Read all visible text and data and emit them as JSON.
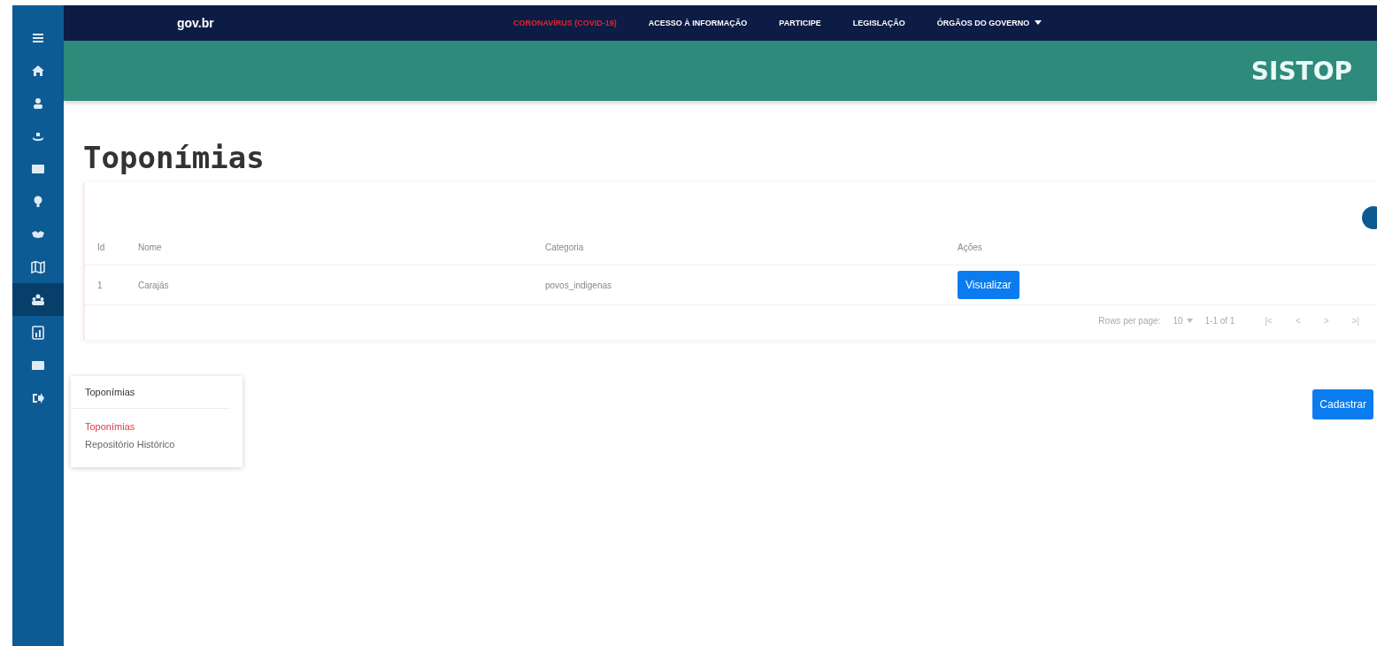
{
  "top_bar": {
    "logo": "gov.br",
    "links": [
      {
        "label": "CORONAVÍRUS (COVID-19)",
        "kind": "alert"
      },
      {
        "label": "ACESSO À INFORMAÇÃO",
        "kind": "normal"
      },
      {
        "label": "PARTICIPE",
        "kind": "normal"
      },
      {
        "label": "LEGISLAÇÃO",
        "kind": "normal"
      },
      {
        "label": "ÓRGÃOS DO GOVERNO",
        "kind": "dropdown"
      }
    ]
  },
  "header": {
    "title": "SISTOP"
  },
  "sidebar": {
    "items": [
      {
        "selected": false
      },
      {
        "selected": false
      },
      {
        "selected": false
      },
      {
        "selected": false
      },
      {
        "selected": false
      },
      {
        "selected": false
      },
      {
        "selected": false
      },
      {
        "selected": false
      },
      {
        "selected": true
      },
      {
        "selected": false
      },
      {
        "selected": false
      },
      {
        "selected": false
      }
    ]
  },
  "flyout_menu": {
    "title": "Toponímias",
    "items": [
      {
        "label": "Toponímias",
        "selected": true
      },
      {
        "label": "Repositório Histórico",
        "selected": false
      }
    ]
  },
  "page": {
    "title": "Toponímias"
  },
  "table": {
    "columns": [
      "Id",
      "Nome",
      "Categoria",
      "Ações"
    ],
    "rows": [
      {
        "id": "1",
        "name": "Carajás",
        "category": "povos_indigenas",
        "action": "Visualizar"
      }
    ]
  },
  "pagination": {
    "rows_label": "Rows per page:",
    "rows_value": "10",
    "range": "1-1 of 1",
    "buttons": [
      "|<",
      "<",
      ">",
      ">|"
    ]
  },
  "create_button": "Cadastrar"
}
